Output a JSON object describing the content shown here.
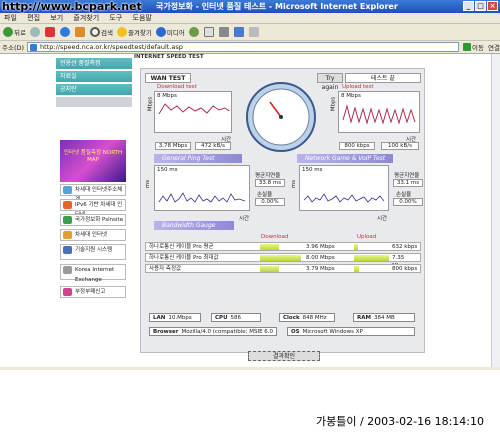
{
  "window": {
    "title": "국가정보화 - 인터넷 품질 테스트 - Microsoft Internet Explorer",
    "watermark": "http://www.bcpark.net",
    "menu": [
      "파일",
      "편집",
      "보기",
      "즐겨찾기",
      "도구",
      "도움말"
    ]
  },
  "toolbar": {
    "back": "뒤로",
    "search": "검색",
    "favorites": "즐겨찾기",
    "media": "미디어"
  },
  "address": {
    "label": "주소(D)",
    "url": "http://speed.nca.or.kr/speedtest/default.asp",
    "go": "이동",
    "links": "연결"
  },
  "sidebar": {
    "items": [
      "전용선 품질측정",
      "자료실",
      "공지란"
    ],
    "banner": "인터넷 품질측정 NORTH MAP",
    "buttons": [
      "차세대 인터넷주소체계",
      "IPv6 기반 차세대 인터넷",
      "국가정보화 Pslnsite",
      "차세대 인터넷",
      "기술지원 시스템",
      "Korea Internet Exchange",
      "부정부패신고"
    ]
  },
  "content": {
    "header": "INTERNET SPEED TEST",
    "tab_wan": "WAN TEST",
    "tab_try": "Try again",
    "tab_test": "테스트 끝",
    "download": {
      "title": "Download test",
      "scale": "8 Mbps",
      "axis_y": "Mbps",
      "axis_x": "시간",
      "speed": "3.78 Mbps",
      "size": "472 kB/s"
    },
    "upload": {
      "title": "Upload test",
      "scale": "8 Mbps",
      "axis_y": "Mbps",
      "axis_x": "시간",
      "speed": "800 kbps",
      "size": "100 kB/s"
    },
    "ping": {
      "title": "General Ping Test",
      "scale": "150 ms",
      "axis_y": "ms",
      "axis_x": "시간",
      "avg_label": "평균지연율",
      "avg": "33.8 ms",
      "loss_label": "손실율",
      "loss": "0.00%"
    },
    "voip": {
      "title": "Network Game & VoIP Test",
      "scale": "150 ms",
      "axis_y": "ms",
      "axis_x": "시간",
      "avg_label": "평균지연율",
      "avg": "33.1 ms",
      "loss_label": "손실율",
      "loss": "0.00%"
    },
    "bandwidth": {
      "title": "Bandwidth Gauge",
      "download_label": "Download",
      "upload_label": "Upload",
      "rows": [
        {
          "name": "하나로통신 케이블 Pro 평균",
          "down": "3.96 Mbps",
          "down_frac": 0.16,
          "up": "632 kbps",
          "up_frac": 0.12
        },
        {
          "name": "하나로통신 케이블 Pro 최대값",
          "down": "8.00 Mbps",
          "down_frac": 0.34,
          "up": "7.35 Mbps",
          "up_frac": 0.98
        },
        {
          "name": "사용자 측정값",
          "down": "3.79 Mbps",
          "down_frac": 0.16,
          "up": "800 kbps",
          "up_frac": 0.14
        }
      ]
    },
    "info": {
      "lan_label": "LAN",
      "lan": "10.Mbps",
      "cpu_label": "CPU",
      "cpu": "586",
      "clock_label": "Clock",
      "clock": "848 MHz",
      "ram_label": "RAM",
      "ram": "384 MB",
      "browser_label": "Browser",
      "browser": "Mozilla/4.0 (compatible; MSIE 6.0",
      "os_label": "OS",
      "os": "Microsoft Windows XP"
    },
    "result_button": "결과확인"
  },
  "caption": "가봉틀이 / 2003-02-16 18:14:10",
  "colors": {
    "accent": "#5fbfc1",
    "section": "#8f89d6",
    "bar": "#b9d93a",
    "line_down": "#b12d4a",
    "line_ping": "#3b2d8f"
  }
}
